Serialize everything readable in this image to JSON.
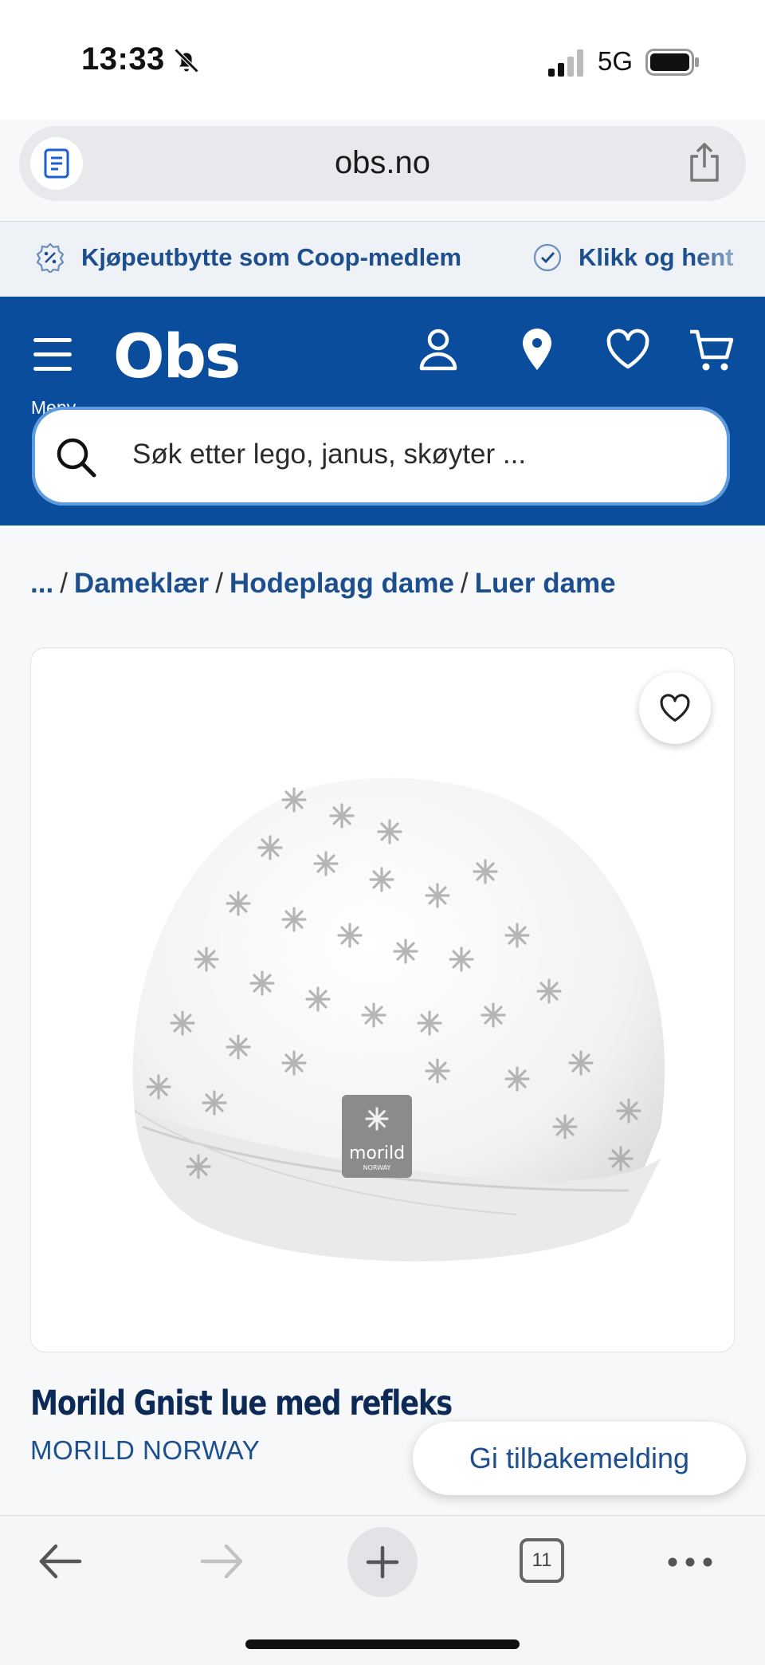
{
  "status_bar": {
    "time": "13:33",
    "network": "5G",
    "icons": [
      "bell-slash-icon",
      "signal-icon",
      "battery-icon"
    ]
  },
  "browser": {
    "url": "obs.no",
    "tab_count": "11",
    "icons": [
      "reader-icon",
      "share-icon",
      "back-icon",
      "forward-icon",
      "new-tab-icon",
      "tabs-icon",
      "more-icon"
    ]
  },
  "promo": {
    "items": [
      {
        "label": "Kjøpeutbytte som Coop-medlem",
        "icon": "percent-badge-icon"
      },
      {
        "label": "Klikk og hent",
        "icon": "check-badge-icon"
      }
    ]
  },
  "header": {
    "menu_label": "Meny",
    "logo": "Obs",
    "search_placeholder": "Søk etter lego, janus, skøyter ...",
    "icons": [
      "menu-icon",
      "account-icon",
      "location-icon",
      "heart-icon",
      "cart-icon",
      "search-icon"
    ]
  },
  "breadcrumb": {
    "ellipsis": "...",
    "items": [
      "Dameklær",
      "Hodeplagg dame",
      "Luer dame"
    ],
    "separator": "/"
  },
  "product": {
    "title": "Morild Gnist lue med refleks",
    "brand": "MORILD NORWAY",
    "label_text": "morild",
    "label_subtext": "NORWAY",
    "image_icon": "beanie-hat-image"
  },
  "feedback": {
    "label": "Gi tilbakemelding"
  },
  "colors": {
    "brand_blue": "#0a4d9c",
    "link_blue": "#1d4f8f",
    "title_navy": "#0d2a57"
  }
}
